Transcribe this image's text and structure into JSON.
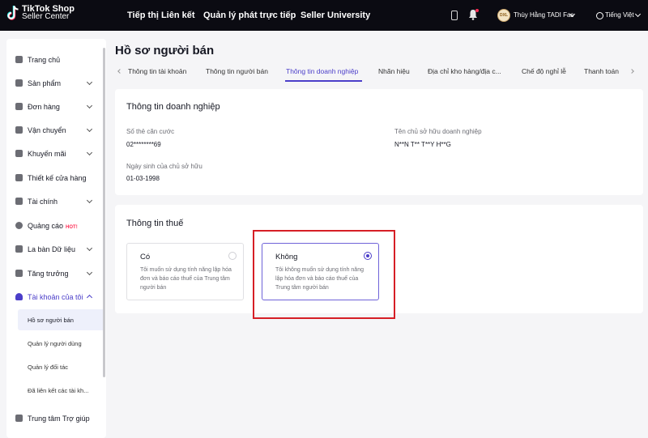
{
  "header": {
    "logo_line1": "TikTok Shop",
    "logo_line2": "Seller Center",
    "nav": [
      "Tiếp thị Liên kết",
      "Quản lý phát trực tiếp",
      "Seller University"
    ],
    "avatar_text": "DXL",
    "shop_name": "Thùy Hằng TADI Fas",
    "language": "Tiếng Việt"
  },
  "sidebar": {
    "items": [
      {
        "label": "Trang chủ",
        "icon": "home-icon"
      },
      {
        "label": "Sản phẩm",
        "icon": "product-icon"
      },
      {
        "label": "Đơn hàng",
        "icon": "order-icon"
      },
      {
        "label": "Vận chuyển",
        "icon": "truck-icon"
      },
      {
        "label": "Khuyến mãi",
        "icon": "megaphone-icon"
      },
      {
        "label": "Thiết kế cửa hàng",
        "icon": "store-icon"
      },
      {
        "label": "Tài chính",
        "icon": "card-icon"
      },
      {
        "label": "Quảng cáo",
        "icon": "ads-icon",
        "badge": "HOT!"
      },
      {
        "label": "La bàn Dữ liệu",
        "icon": "chart-icon"
      },
      {
        "label": "Tăng trưởng",
        "icon": "growth-icon"
      },
      {
        "label": "Tài khoản của tôi",
        "icon": "user-icon"
      }
    ],
    "sub_items": [
      "Hồ sơ người bán",
      "Quản lý người dùng",
      "Quản lý đối tác",
      "Đã liên kết các tài kh..."
    ],
    "help": "Trung tâm Trợ giúp"
  },
  "page": {
    "title": "Hồ sơ người bán",
    "tabs": [
      "Thông tin tài khoản",
      "Thông tin người bán",
      "Thông tin doanh nghiệp",
      "Nhãn hiệu",
      "Địa chỉ kho hàng/địa c...",
      "Chế độ nghỉ lễ",
      "Thanh toán"
    ],
    "active_tab": "Thông tin doanh nghiệp"
  },
  "business": {
    "title": "Thông tin doanh nghiệp",
    "id_label": "Số thẻ căn cước",
    "id_value": "02********69",
    "owner_label": "Tên chủ sở hữu doanh nghiệp",
    "owner_value": "N**N T** T**Y H**G",
    "dob_label": "Ngày sinh của chủ sở hữu",
    "dob_value": "01-03-1998"
  },
  "tax": {
    "title": "Thông tin thuế",
    "options": [
      {
        "title": "Có",
        "desc": "Tôi muốn sử dụng tính năng lập hóa đơn và báo cáo thuế của Trung tâm người bán",
        "selected": false
      },
      {
        "title": "Không",
        "desc": "Tôi không muốn sử dụng tính năng lập hóa đơn và báo cáo thuế của Trung tâm người bán",
        "selected": true
      }
    ]
  },
  "colors": {
    "accent": "#4b3ec9",
    "highlight": "#d61f26",
    "topbar": "#0b0b12"
  }
}
